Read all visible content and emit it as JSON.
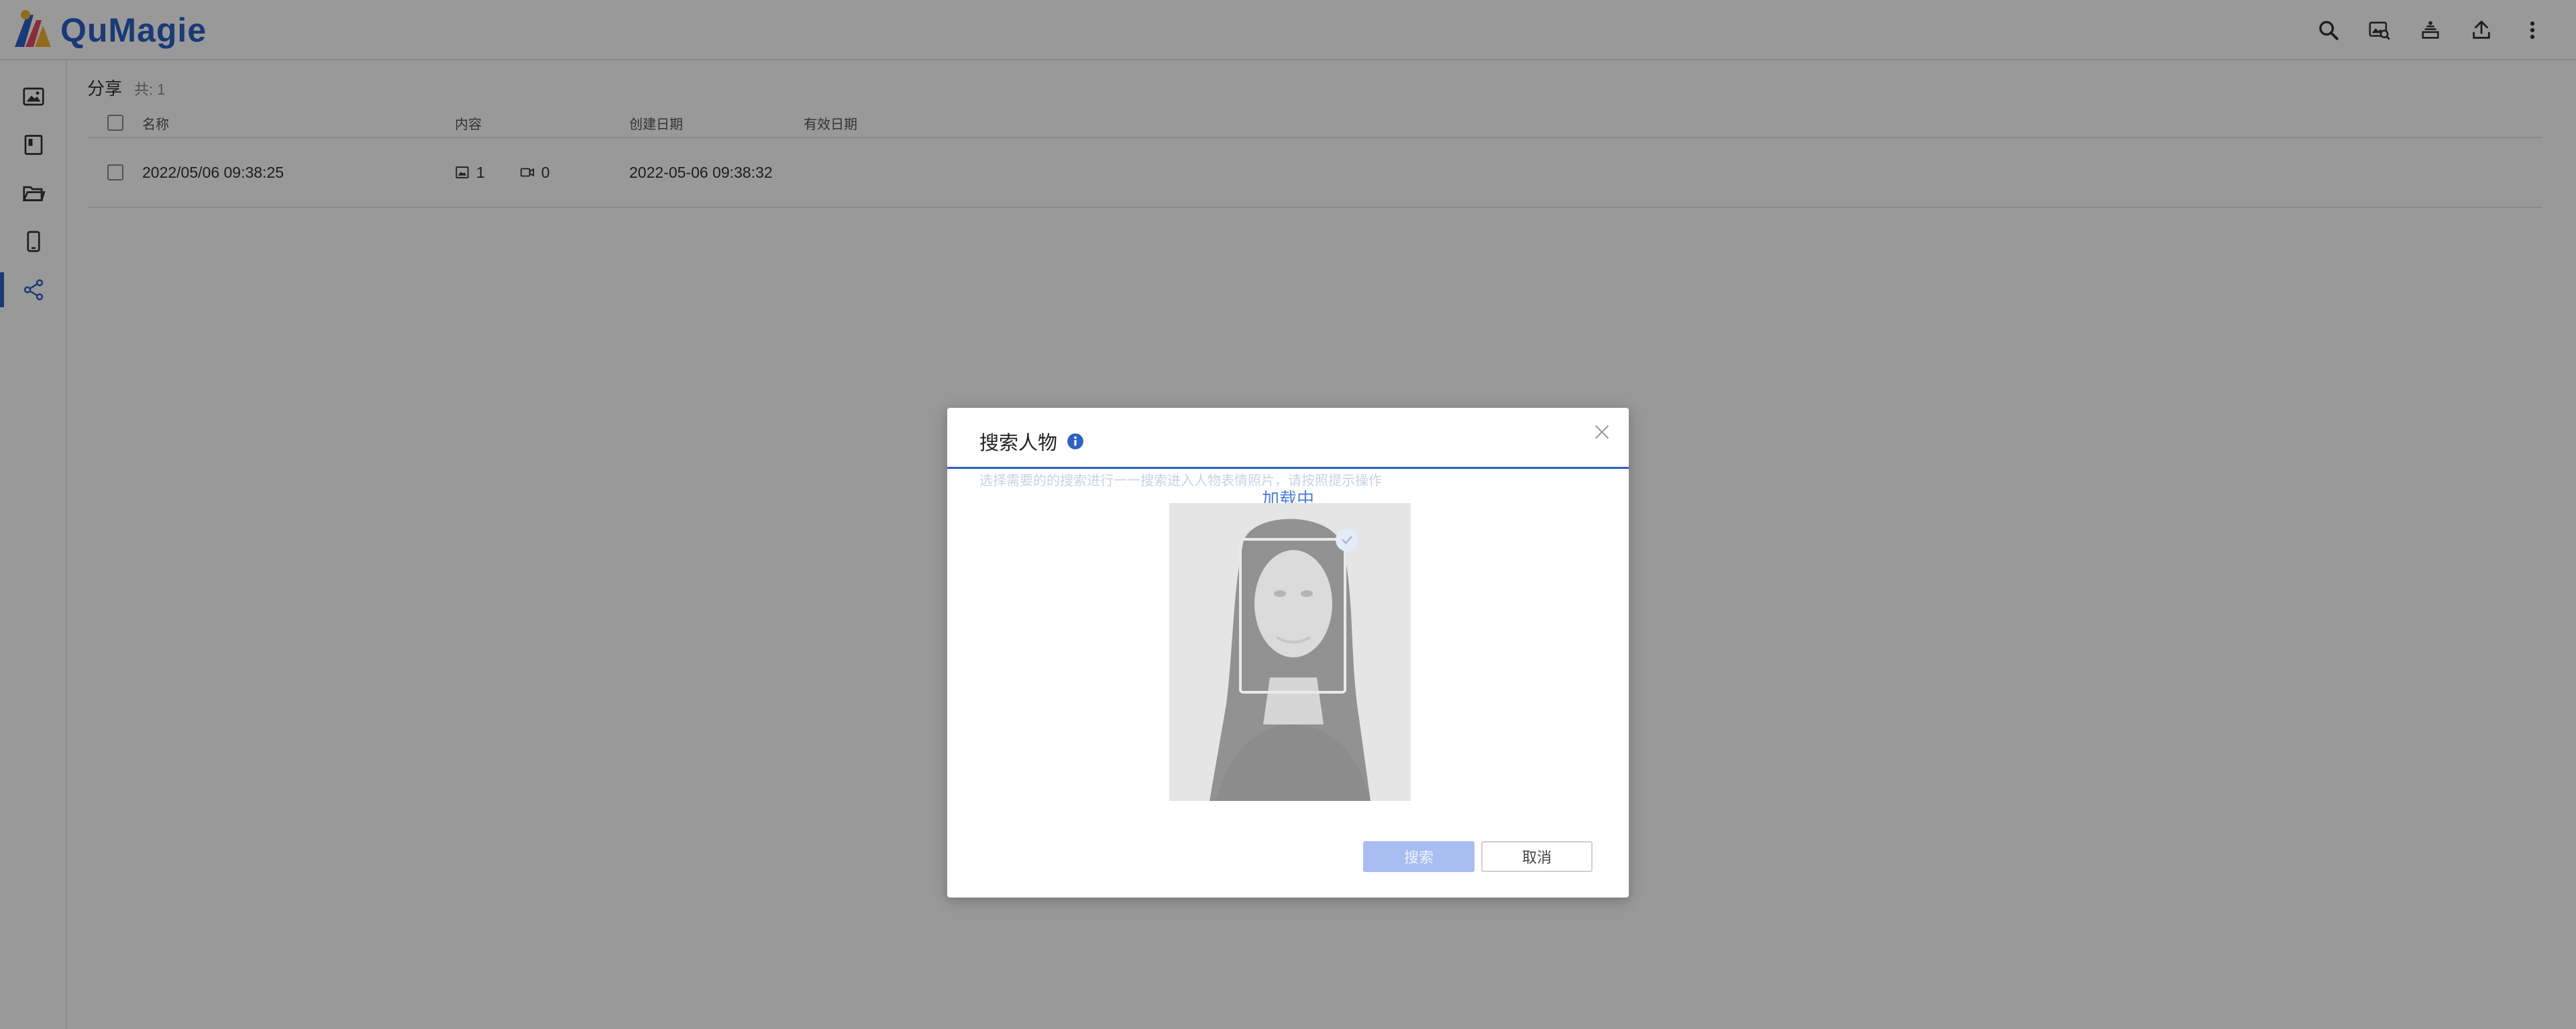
{
  "app": {
    "name": "QuMagie",
    "brand_color": "#2b62c4"
  },
  "header": {
    "actions": [
      {
        "icon": "search-icon"
      },
      {
        "icon": "image-search-icon"
      },
      {
        "icon": "background-task-icon"
      },
      {
        "icon": "upload-icon"
      },
      {
        "icon": "more-vertical-icon"
      }
    ]
  },
  "sidebar": {
    "items": [
      {
        "icon": "photos-icon"
      },
      {
        "icon": "albums-icon"
      },
      {
        "icon": "folder-icon"
      },
      {
        "icon": "mobile-icon"
      },
      {
        "icon": "share-icon",
        "active": true
      }
    ]
  },
  "main": {
    "title": "分享",
    "count": "共: 1",
    "table": {
      "headers": {
        "name": "名称",
        "content": "内容",
        "created": "创建日期",
        "expiry": "有效日期"
      },
      "rows": [
        {
          "name": "2022/05/06 09:38:25",
          "photos": "1",
          "videos": "0",
          "created": "2022-05-06 09:38:32",
          "expiry": ""
        }
      ]
    }
  },
  "dialog": {
    "title": "搜索人物",
    "hint": "选择需要的的搜索进行一一搜索进入人物表情照片，请按照提示操作",
    "loading": "加载中",
    "search_button": "搜索",
    "cancel_button": "取消"
  }
}
